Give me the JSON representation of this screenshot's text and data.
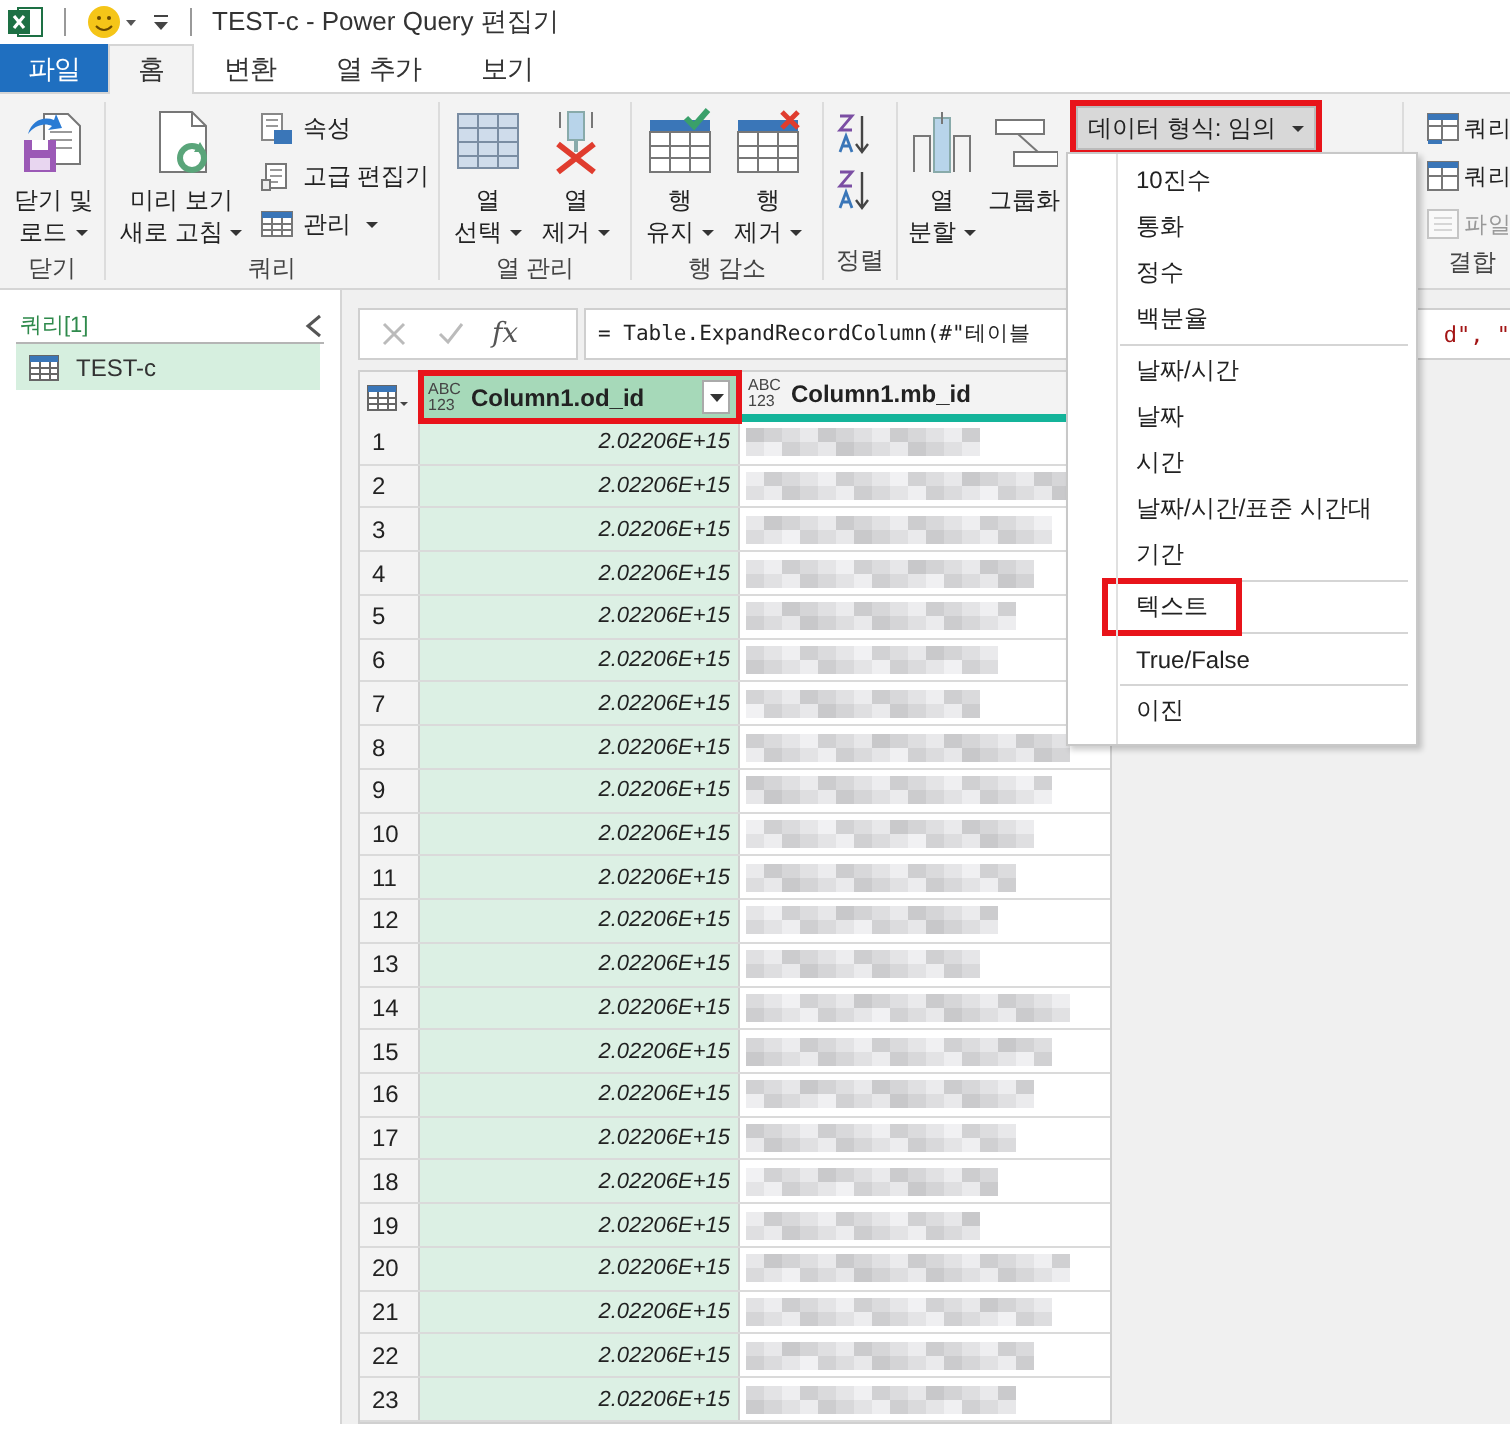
{
  "title_bar": {
    "title": "TEST-c - Power Query 편집기"
  },
  "tabs": [
    {
      "label": "파일",
      "kind": "file",
      "selected": false
    },
    {
      "label": "홈",
      "kind": "tab",
      "selected": true
    },
    {
      "label": "변환",
      "kind": "tab",
      "selected": false
    },
    {
      "label": "열 추가",
      "kind": "tab",
      "selected": false
    },
    {
      "label": "보기",
      "kind": "tab",
      "selected": false
    }
  ],
  "ribbon": {
    "groups": [
      {
        "label": "닫기",
        "items": [
          {
            "kind": "large",
            "label": "닫기 및\n로드",
            "dropdown": true
          }
        ]
      },
      {
        "label": "쿼리",
        "items": [
          {
            "kind": "large",
            "label": "미리 보기\n새로 고침",
            "dropdown": true
          },
          {
            "kind": "small",
            "label": "속성",
            "dropdown": false,
            "disabled": false
          },
          {
            "kind": "small",
            "label": "고급 편집기",
            "dropdown": false,
            "disabled": false
          },
          {
            "kind": "small",
            "label": "관리",
            "dropdown": true,
            "disabled": false
          }
        ]
      },
      {
        "label": "열 관리",
        "items": [
          {
            "kind": "large",
            "label": "열\n선택",
            "dropdown": true
          },
          {
            "kind": "large",
            "label": "열\n제거",
            "dropdown": true
          }
        ]
      },
      {
        "label": "행 감소",
        "items": [
          {
            "kind": "large",
            "label": "행\n유지",
            "dropdown": true
          },
          {
            "kind": "large",
            "label": "행\n제거",
            "dropdown": true
          }
        ]
      },
      {
        "label": "정렬",
        "items": [
          {
            "kind": "icon"
          },
          {
            "kind": "icon"
          }
        ]
      },
      {
        "items": [
          {
            "kind": "large",
            "label": "열\n분할",
            "dropdown": true
          },
          {
            "kind": "large",
            "label": "그룹화",
            "dropdown": false
          },
          {
            "kind": "select",
            "label": "데이터 형식: 임의",
            "dropdown": true,
            "highlighted": true
          }
        ]
      },
      {
        "label": "결합",
        "items": [
          {
            "kind": "small",
            "label": "쿼리",
            "dropdown": false,
            "disabled": false
          },
          {
            "kind": "small",
            "label": "쿼리",
            "dropdown": false,
            "disabled": false
          },
          {
            "kind": "small",
            "label": "파일",
            "dropdown": false,
            "disabled": true
          }
        ]
      }
    ]
  },
  "queries_pane": {
    "header": "쿼리[1]",
    "items": [
      {
        "label": "TEST-c",
        "selected": true
      }
    ]
  },
  "formula_bar": {
    "function_label": "fx",
    "formula": "= Table.ExpandRecordColumn(#\"테이블",
    "formula_tail": "d\", \""
  },
  "table": {
    "columns": [
      {
        "type_label": "ABC\n123",
        "title": "Column1.od_id",
        "selected": true,
        "highlighted": true
      },
      {
        "type_label": "ABC\n123",
        "title": "Column1.mb_id",
        "selected": false,
        "highlighted": false
      }
    ],
    "rows": [
      {
        "index": "1",
        "value": "2.02206E+15"
      },
      {
        "index": "2",
        "value": "2.02206E+15"
      },
      {
        "index": "3",
        "value": "2.02206E+15"
      },
      {
        "index": "4",
        "value": "2.02206E+15"
      },
      {
        "index": "5",
        "value": "2.02206E+15"
      },
      {
        "index": "6",
        "value": "2.02206E+15"
      },
      {
        "index": "7",
        "value": "2.02206E+15"
      },
      {
        "index": "8",
        "value": "2.02206E+15"
      },
      {
        "index": "9",
        "value": "2.02206E+15"
      },
      {
        "index": "10",
        "value": "2.02206E+15"
      },
      {
        "index": "11",
        "value": "2.02206E+15"
      },
      {
        "index": "12",
        "value": "2.02206E+15"
      },
      {
        "index": "13",
        "value": "2.02206E+15"
      },
      {
        "index": "14",
        "value": "2.02206E+15"
      },
      {
        "index": "15",
        "value": "2.02206E+15"
      },
      {
        "index": "16",
        "value": "2.02206E+15"
      },
      {
        "index": "17",
        "value": "2.02206E+15"
      },
      {
        "index": "18",
        "value": "2.02206E+15"
      },
      {
        "index": "19",
        "value": "2.02206E+15"
      },
      {
        "index": "20",
        "value": "2.02206E+15"
      },
      {
        "index": "21",
        "value": "2.02206E+15"
      },
      {
        "index": "22",
        "value": "2.02206E+15"
      },
      {
        "index": "23",
        "value": "2.02206E+15"
      }
    ]
  },
  "type_menu": {
    "sections": [
      [
        {
          "label": "10진수",
          "highlighted": false
        },
        {
          "label": "통화",
          "highlighted": false
        },
        {
          "label": "정수",
          "highlighted": false
        },
        {
          "label": "백분율",
          "highlighted": false
        }
      ],
      [
        {
          "label": "날짜/시간",
          "highlighted": false
        },
        {
          "label": "날짜",
          "highlighted": false
        },
        {
          "label": "시간",
          "highlighted": false
        },
        {
          "label": "날짜/시간/표준 시간대",
          "highlighted": false
        },
        {
          "label": "기간",
          "highlighted": false
        }
      ],
      [
        {
          "label": "텍스트",
          "highlighted": true
        }
      ],
      [
        {
          "label": "True/False",
          "highlighted": false
        }
      ],
      [
        {
          "label": "이진",
          "highlighted": false
        }
      ]
    ]
  }
}
